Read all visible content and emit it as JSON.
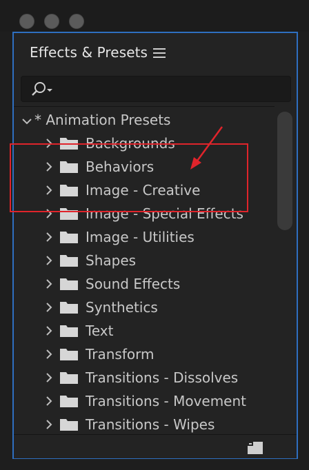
{
  "panel": {
    "title": "Effects & Presets",
    "menu_icon": "hamburger-menu-icon",
    "search": {
      "value": "",
      "icon": "search-icon"
    }
  },
  "tree": {
    "root": {
      "label": "* Animation Presets",
      "expanded": true
    },
    "items": [
      {
        "label": "Backgrounds"
      },
      {
        "label": "Behaviors"
      },
      {
        "label": "Image - Creative"
      },
      {
        "label": "Image - Special Effects"
      },
      {
        "label": "Image - Utilities"
      },
      {
        "label": "Shapes"
      },
      {
        "label": "Sound Effects"
      },
      {
        "label": "Synthetics"
      },
      {
        "label": "Text"
      },
      {
        "label": "Transform"
      },
      {
        "label": "Transitions - Dissolves"
      },
      {
        "label": "Transitions - Movement"
      },
      {
        "label": "Transitions - Wipes"
      }
    ]
  },
  "annotation": {
    "highlight_color": "#e0242b",
    "highlighted_items": [
      "Image - Creative",
      "Image - Special Effects",
      "Image - Utilities"
    ]
  },
  "colors": {
    "focus_border": "#2e6fc0",
    "panel_bg": "#232323",
    "text": "#c8c8c8"
  }
}
